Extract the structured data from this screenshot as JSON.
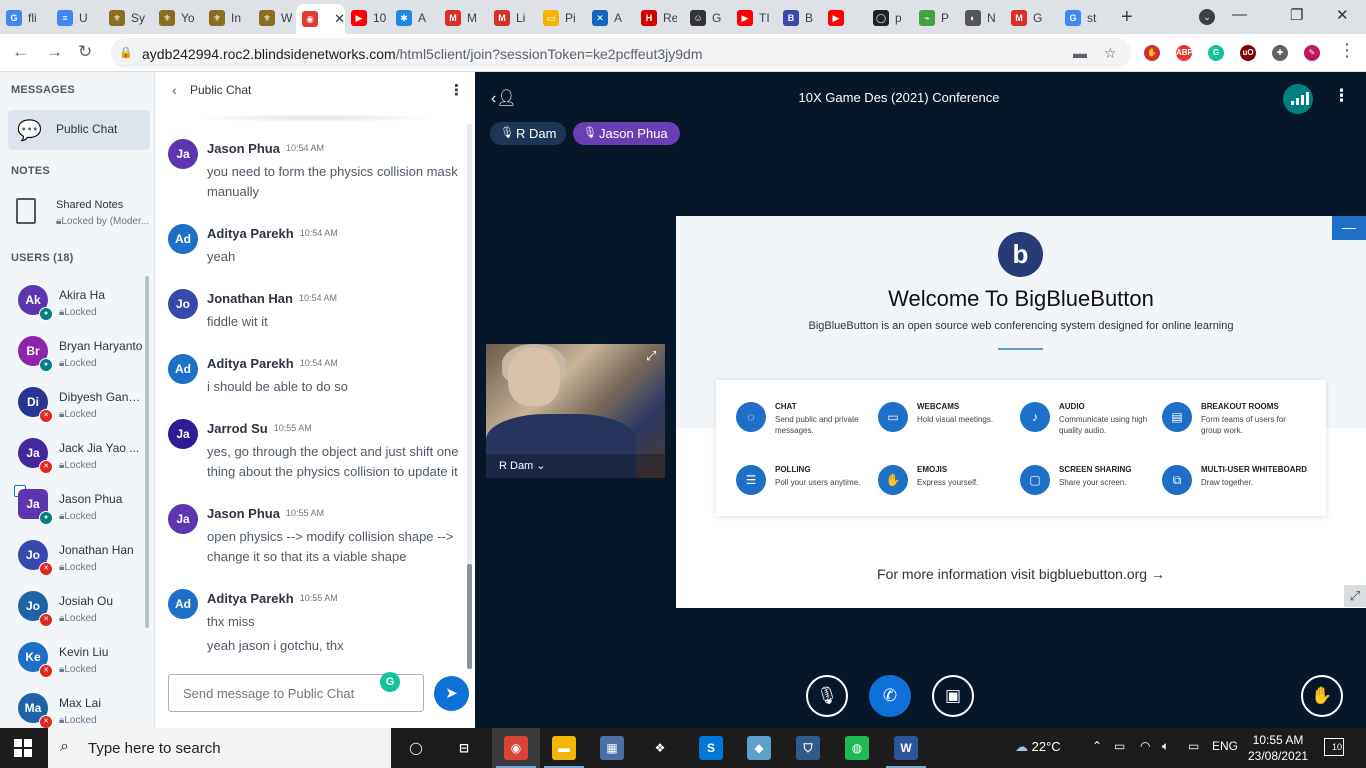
{
  "browser": {
    "tabs": [
      {
        "label": "fli",
        "fav": "G",
        "color": "#4285f4"
      },
      {
        "label": "U",
        "fav": "≡",
        "color": "#4285f4"
      },
      {
        "label": "Sy",
        "fav": "⚜",
        "color": "#8a6d1e"
      },
      {
        "label": "Yo",
        "fav": "⚜",
        "color": "#8a6d1e"
      },
      {
        "label": "In",
        "fav": "⚜",
        "color": "#8a6d1e"
      },
      {
        "label": "W",
        "fav": "⚜",
        "color": "#8a6d1e"
      },
      {
        "label": "",
        "fav": "◉",
        "color": "#e53935"
      },
      {
        "label": "10",
        "fav": "▶",
        "color": "#ff0000"
      },
      {
        "label": "A",
        "fav": "✱",
        "color": "#1e88e5"
      },
      {
        "label": "M",
        "fav": "M",
        "color": "#d93025"
      },
      {
        "label": "Li",
        "fav": "M",
        "color": "#d93025"
      },
      {
        "label": "Pi",
        "fav": "▭",
        "color": "#f4b400"
      },
      {
        "label": "A",
        "fav": "✕",
        "color": "#1565c0"
      },
      {
        "label": "Re",
        "fav": "H",
        "color": "#d50000"
      },
      {
        "label": "G",
        "fav": "☺",
        "color": "#333333"
      },
      {
        "label": "TI",
        "fav": "▶",
        "color": "#ff0000"
      },
      {
        "label": "B",
        "fav": "B",
        "color": "#3949ab"
      },
      {
        "label": "",
        "fav": "▶",
        "color": "#ff0000"
      },
      {
        "label": "p",
        "fav": "◯",
        "color": "#222222"
      },
      {
        "label": "P",
        "fav": "⌁",
        "color": "#43a047"
      },
      {
        "label": "N",
        "fav": "◐",
        "color": "#555555"
      },
      {
        "label": "G",
        "fav": "M",
        "color": "#d93025"
      },
      {
        "label": "st",
        "fav": "G",
        "color": "#4285f4"
      }
    ],
    "active_tab_close": "✕",
    "new_tab": "+",
    "window_controls": [
      "—",
      "❐",
      "✕"
    ],
    "url_host": "aydb242994.roc2.blindsidenetworks.com",
    "url_path": "/html5client/join?sessionToken=ke2pcffeut3jy9dm",
    "extensions": [
      {
        "label": "✋",
        "color": "#d32f2f"
      },
      {
        "label": "ABP",
        "color": "#e53935"
      },
      {
        "label": "G",
        "color": "#15c39a"
      },
      {
        "label": "uO",
        "color": "#800000"
      },
      {
        "label": "✚",
        "color": "#5f6368"
      },
      {
        "label": "✎",
        "color": "#c2185b"
      }
    ]
  },
  "nav": {
    "messages_heading": "MESSAGES",
    "public_chat": "Public Chat",
    "notes_heading": "NOTES",
    "shared_notes": "Shared Notes",
    "shared_notes_status": "Locked by (Moder...",
    "users_heading": "USERS (18)",
    "users": [
      {
        "initials": "Ak",
        "name": "Akira Ha",
        "status": "Locked",
        "color": "#5e35b1",
        "badge": "mic",
        "presenter": false
      },
      {
        "initials": "Br",
        "name": "Bryan Haryanto",
        "status": "Locked",
        "color": "#8e24aa",
        "badge": "mic",
        "presenter": false
      },
      {
        "initials": "Di",
        "name": "Dibyesh Gang...",
        "status": "Locked",
        "color": "#283593",
        "badge": "mute",
        "presenter": false
      },
      {
        "initials": "Ja",
        "name": "Jack Jia Yao ...",
        "status": "Locked",
        "color": "#4527a0",
        "badge": "mute",
        "presenter": false
      },
      {
        "initials": "Ja",
        "name": "Jason Phua",
        "status": "Locked",
        "color": "#5e35b1",
        "badge": "mic",
        "presenter": true
      },
      {
        "initials": "Jo",
        "name": "Jonathan Han",
        "status": "Locked",
        "color": "#3949ab",
        "badge": "mute",
        "presenter": false
      },
      {
        "initials": "Jo",
        "name": "Josiah Ou",
        "status": "Locked",
        "color": "#1e63a8",
        "badge": "mute",
        "presenter": false
      },
      {
        "initials": "Ke",
        "name": "Kevin Liu",
        "status": "Locked",
        "color": "#1e6fc8",
        "badge": "mute",
        "presenter": false
      },
      {
        "initials": "Ma",
        "name": "Max Lai",
        "status": "Locked",
        "color": "#1e63a8",
        "badge": "mute",
        "presenter": false
      }
    ]
  },
  "chat": {
    "title": "Public Chat",
    "messages": [
      {
        "initials": "Ja",
        "sender": "Jason Phua",
        "time": "10:54 AM",
        "color": "#5e35b1",
        "lines": [
          "you need to form the physics collision mask manually"
        ]
      },
      {
        "initials": "Ad",
        "sender": "Aditya Parekh",
        "time": "10:54 AM",
        "color": "#1e6fc8",
        "lines": [
          "yeah"
        ]
      },
      {
        "initials": "Jo",
        "sender": "Jonathan Han",
        "time": "10:54 AM",
        "color": "#3949ab",
        "lines": [
          "fiddle wit it"
        ]
      },
      {
        "initials": "Ad",
        "sender": "Aditya Parekh",
        "time": "10:54 AM",
        "color": "#1e6fc8",
        "lines": [
          "i should be able to do so"
        ]
      },
      {
        "initials": "Ja",
        "sender": "Jarrod Su",
        "time": "10:55 AM",
        "color": "#311b92",
        "lines": [
          "yes, go through the object and just shift one thing about the physics collision to update it"
        ]
      },
      {
        "initials": "Ja",
        "sender": "Jason Phua",
        "time": "10:55 AM",
        "color": "#5e35b1",
        "lines": [
          "open physics --> modify collision shape --> change it so that its a viable shape"
        ]
      },
      {
        "initials": "Ad",
        "sender": "Aditya Parekh",
        "time": "10:55 AM",
        "color": "#1e6fc8",
        "lines": [
          "thx miss",
          "yeah jason i gotchu, thx"
        ]
      }
    ],
    "input_placeholder": "Send message to Public Chat"
  },
  "stage": {
    "meeting_title": "10X Game Des (2021) Conference",
    "talkers": [
      {
        "name": "R Dam",
        "color": "#1d3656"
      },
      {
        "name": "Jason Phua",
        "color": "#6a3fb3"
      }
    ],
    "webcam_name": "R Dam ⌄",
    "presentation": {
      "logo": "b",
      "title": "Welcome To BigBlueButton",
      "subtitle": "BigBlueButton is an open source web conferencing system designed for online learning",
      "features": [
        {
          "icon": "◌",
          "name": "CHAT",
          "desc": "Send public and private messages."
        },
        {
          "icon": "▭",
          "name": "WEBCAMS",
          "desc": "Hold visual meetings."
        },
        {
          "icon": "♪",
          "name": "AUDIO",
          "desc": "Communicate using high quality audio."
        },
        {
          "icon": "▤",
          "name": "BREAKOUT ROOMS",
          "desc": "Form teams of users for group work."
        },
        {
          "icon": "☰",
          "name": "POLLING",
          "desc": "Poll your users anytime."
        },
        {
          "icon": "✋",
          "name": "EMOJIS",
          "desc": "Express yourself."
        },
        {
          "icon": "▢",
          "name": "SCREEN SHARING",
          "desc": "Share your screen."
        },
        {
          "icon": "⧉",
          "name": "MULTI-USER WHITEBOARD",
          "desc": "Draw together."
        }
      ],
      "footer": "For more information visit bigbluebutton.org →"
    },
    "actions": [
      {
        "name": "mute-mic-button",
        "icon": "🎙"
      },
      {
        "name": "leave-audio-button",
        "icon": "✆"
      },
      {
        "name": "share-webcam-button",
        "icon": "▣"
      },
      {
        "name": "raise-hand-button",
        "icon": "✋"
      }
    ]
  },
  "taskbar": {
    "search_text": "Type here to search",
    "weather": "22°C",
    "lang": "ENG",
    "time": "10:55 AM",
    "date": "23/08/2021",
    "notifications": "10",
    "pinned": [
      {
        "label": "◯",
        "color": "#1c1c1c"
      },
      {
        "label": "⊟",
        "color": "#1c1c1c"
      },
      {
        "label": "◉",
        "color": "#db4437"
      },
      {
        "label": "▬",
        "color": "#f2b705"
      },
      {
        "label": "▦",
        "color": "#4a6fa5"
      },
      {
        "label": "❖",
        "color": "#1c1c1c"
      },
      {
        "label": "S",
        "color": "#0078d7"
      },
      {
        "label": "◆",
        "color": "#5aa0c8"
      },
      {
        "label": "⛉",
        "color": "#2f5a8a"
      },
      {
        "label": "◍",
        "color": "#1db954"
      },
      {
        "label": "W",
        "color": "#2b579a"
      }
    ]
  }
}
